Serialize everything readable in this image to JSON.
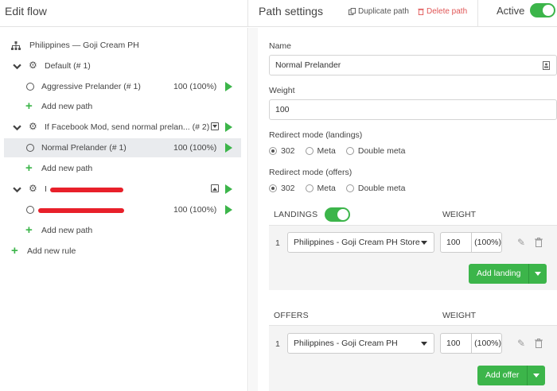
{
  "header": {
    "left_title": "Edit flow",
    "right_title": "Path settings",
    "duplicate_label": "Duplicate path",
    "delete_label": "Delete path",
    "active_label": "Active"
  },
  "tree": {
    "root_label": "Philippines — Goji Cream PH",
    "rules": [
      {
        "label": "Default (# 1)",
        "paths": [
          {
            "label": "Aggressive Prelander (# 1)",
            "weight": "100 (100%)"
          }
        ],
        "add_path": "Add new path"
      },
      {
        "label": "If Facebook Mod, send normal prelan... (# 2)",
        "paths": [
          {
            "label": "Normal Prelander (# 1)",
            "weight": "100 (100%)"
          }
        ],
        "add_path": "Add new path"
      },
      {
        "label": "I",
        "paths": [
          {
            "label": "",
            "weight": "100 (100%)"
          }
        ],
        "add_path": "Add new path"
      }
    ],
    "add_rule": "Add new rule"
  },
  "settings": {
    "name_label": "Name",
    "name_value": "Normal Prelander",
    "weight_label": "Weight",
    "weight_value": "100",
    "redirect_landings_label": "Redirect mode (landings)",
    "redirect_offers_label": "Redirect mode (offers)",
    "redirect_options": [
      "302",
      "Meta",
      "Double meta"
    ]
  },
  "landings": {
    "header": "LANDINGS",
    "weight_header": "WEIGHT",
    "rows": [
      {
        "index": "1",
        "name": "Philippines - Goji Cream PH Store",
        "weight": "100",
        "percent": "(100%)"
      }
    ],
    "add_label": "Add landing"
  },
  "offers": {
    "header": "OFFERS",
    "weight_header": "WEIGHT",
    "rows": [
      {
        "index": "1",
        "name": "Philippines - Goji Cream PH",
        "weight": "100",
        "percent": "(100%)"
      }
    ],
    "add_label": "Add offer"
  },
  "colors": {
    "accent": "#3cb54a",
    "danger": "#e05555",
    "selected_row": "#e9ebee"
  }
}
